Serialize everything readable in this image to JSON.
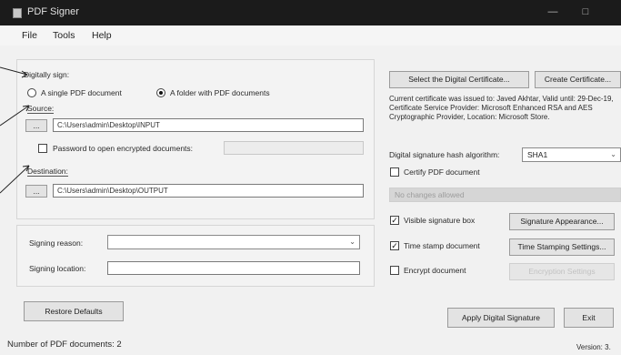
{
  "window": {
    "title": "PDF Signer"
  },
  "menu": [
    "File",
    "Tools",
    "Help"
  ],
  "sign": {
    "heading": "Digitally sign:",
    "mode_single": "A single PDF document",
    "mode_folder": "A folder with PDF documents",
    "selected_mode": "folder",
    "source_label": "Source:",
    "source_path": "C:\\Users\\admin\\Desktop\\INPUT",
    "password_label": "Password to open encrypted documents:",
    "password_checked": false,
    "destination_label": "Destination:",
    "destination_path": "C:\\Users\\admin\\Desktop\\OUTPUT",
    "browse_label": "..."
  },
  "signing": {
    "reason_label": "Signing reason:",
    "reason_value": "",
    "location_label": "Signing location:",
    "location_value": ""
  },
  "certificate": {
    "select_button": "Select the Digital Certificate...",
    "create_button": "Create Certificate...",
    "info": "Current certificate was issued to: Javed Akhtar, Valid until: 29-Dec-19, Certificate Service Provider: Microsoft Enhanced RSA and AES Cryptographic Provider, Location: Microsoft Store.",
    "hash_label": "Digital signature hash algorithm:",
    "hash_value": "SHA1",
    "certify_label": "Certify PDF document",
    "certify_checked": false,
    "changes_value": "No changes allowed"
  },
  "options": {
    "visible_label": "Visible signature box",
    "visible_checked": true,
    "appearance_button": "Signature Appearance...",
    "timestamp_label": "Time stamp document",
    "timestamp_checked": true,
    "timestamp_button": "Time Stamping Settings...",
    "encrypt_label": "Encrypt document",
    "encrypt_checked": false,
    "encrypt_button": "Encryption Settings"
  },
  "actions": {
    "restore": "Restore Defaults",
    "apply": "Apply Digital Signature",
    "exit": "Exit"
  },
  "status": {
    "count": "Number of PDF documents: 2",
    "version": "Version: 3."
  }
}
